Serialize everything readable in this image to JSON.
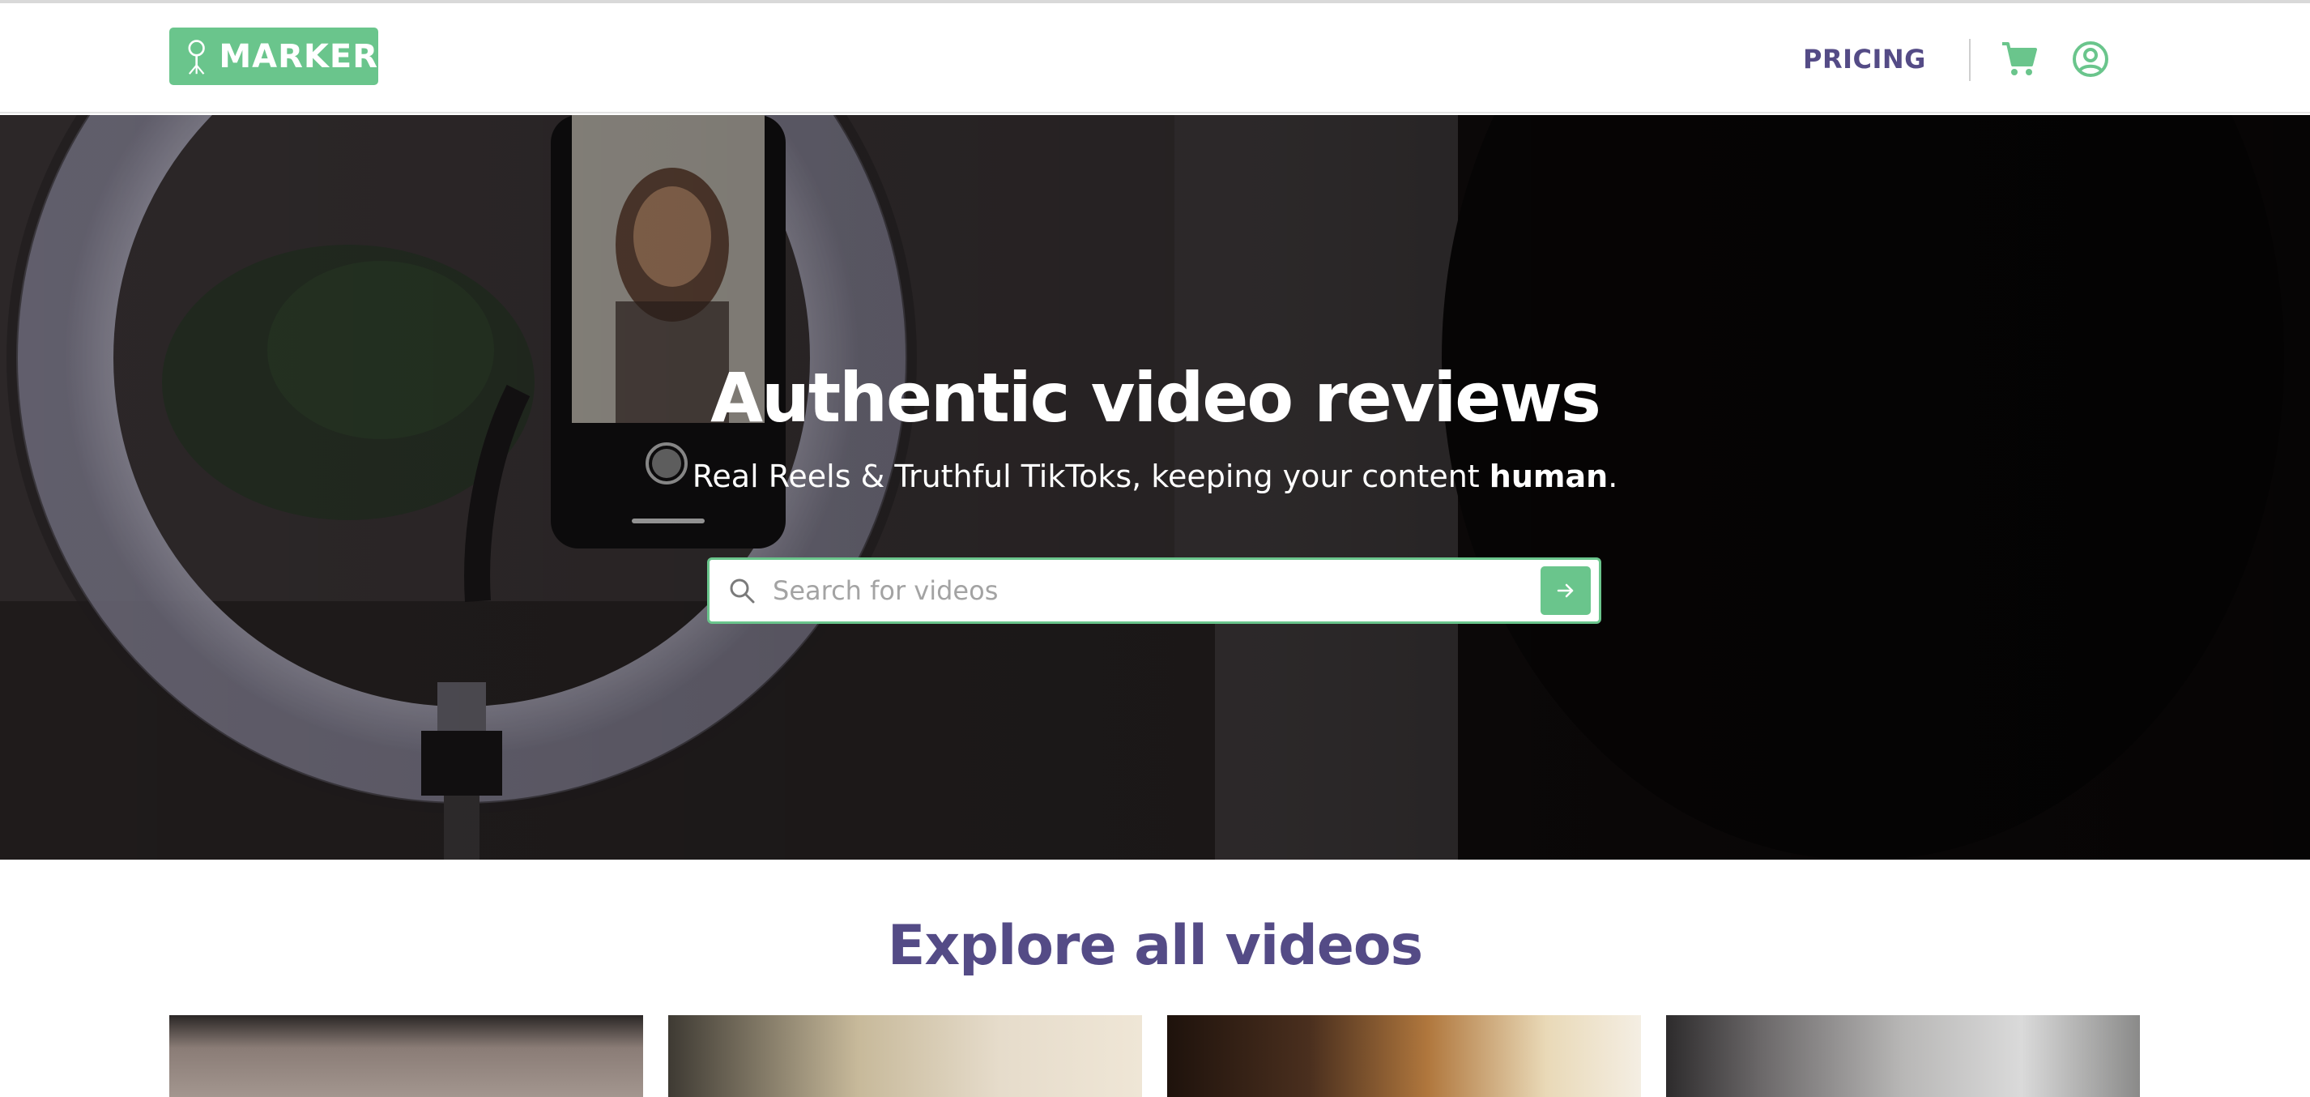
{
  "header": {
    "logo_text": "MARKER",
    "nav": {
      "pricing_label": "PRICING"
    },
    "icons": {
      "logo": "ring-light-icon",
      "cart": "cart-icon",
      "account": "user-circle-icon"
    }
  },
  "hero": {
    "title": "Authentic video reviews",
    "subtitle_prefix": "Real Reels & Truthful TikToks, keeping your content ",
    "subtitle_emphasis": "human",
    "subtitle_suffix": ".",
    "search": {
      "placeholder": "Search for videos",
      "value": ""
    }
  },
  "explore": {
    "title": "Explore all videos",
    "videos": [
      "video-1",
      "video-2",
      "video-3",
      "video-4"
    ]
  },
  "colors": {
    "accent_green": "#6ac58c",
    "brand_purple": "#544b86",
    "hero_text": "#ffffff"
  }
}
